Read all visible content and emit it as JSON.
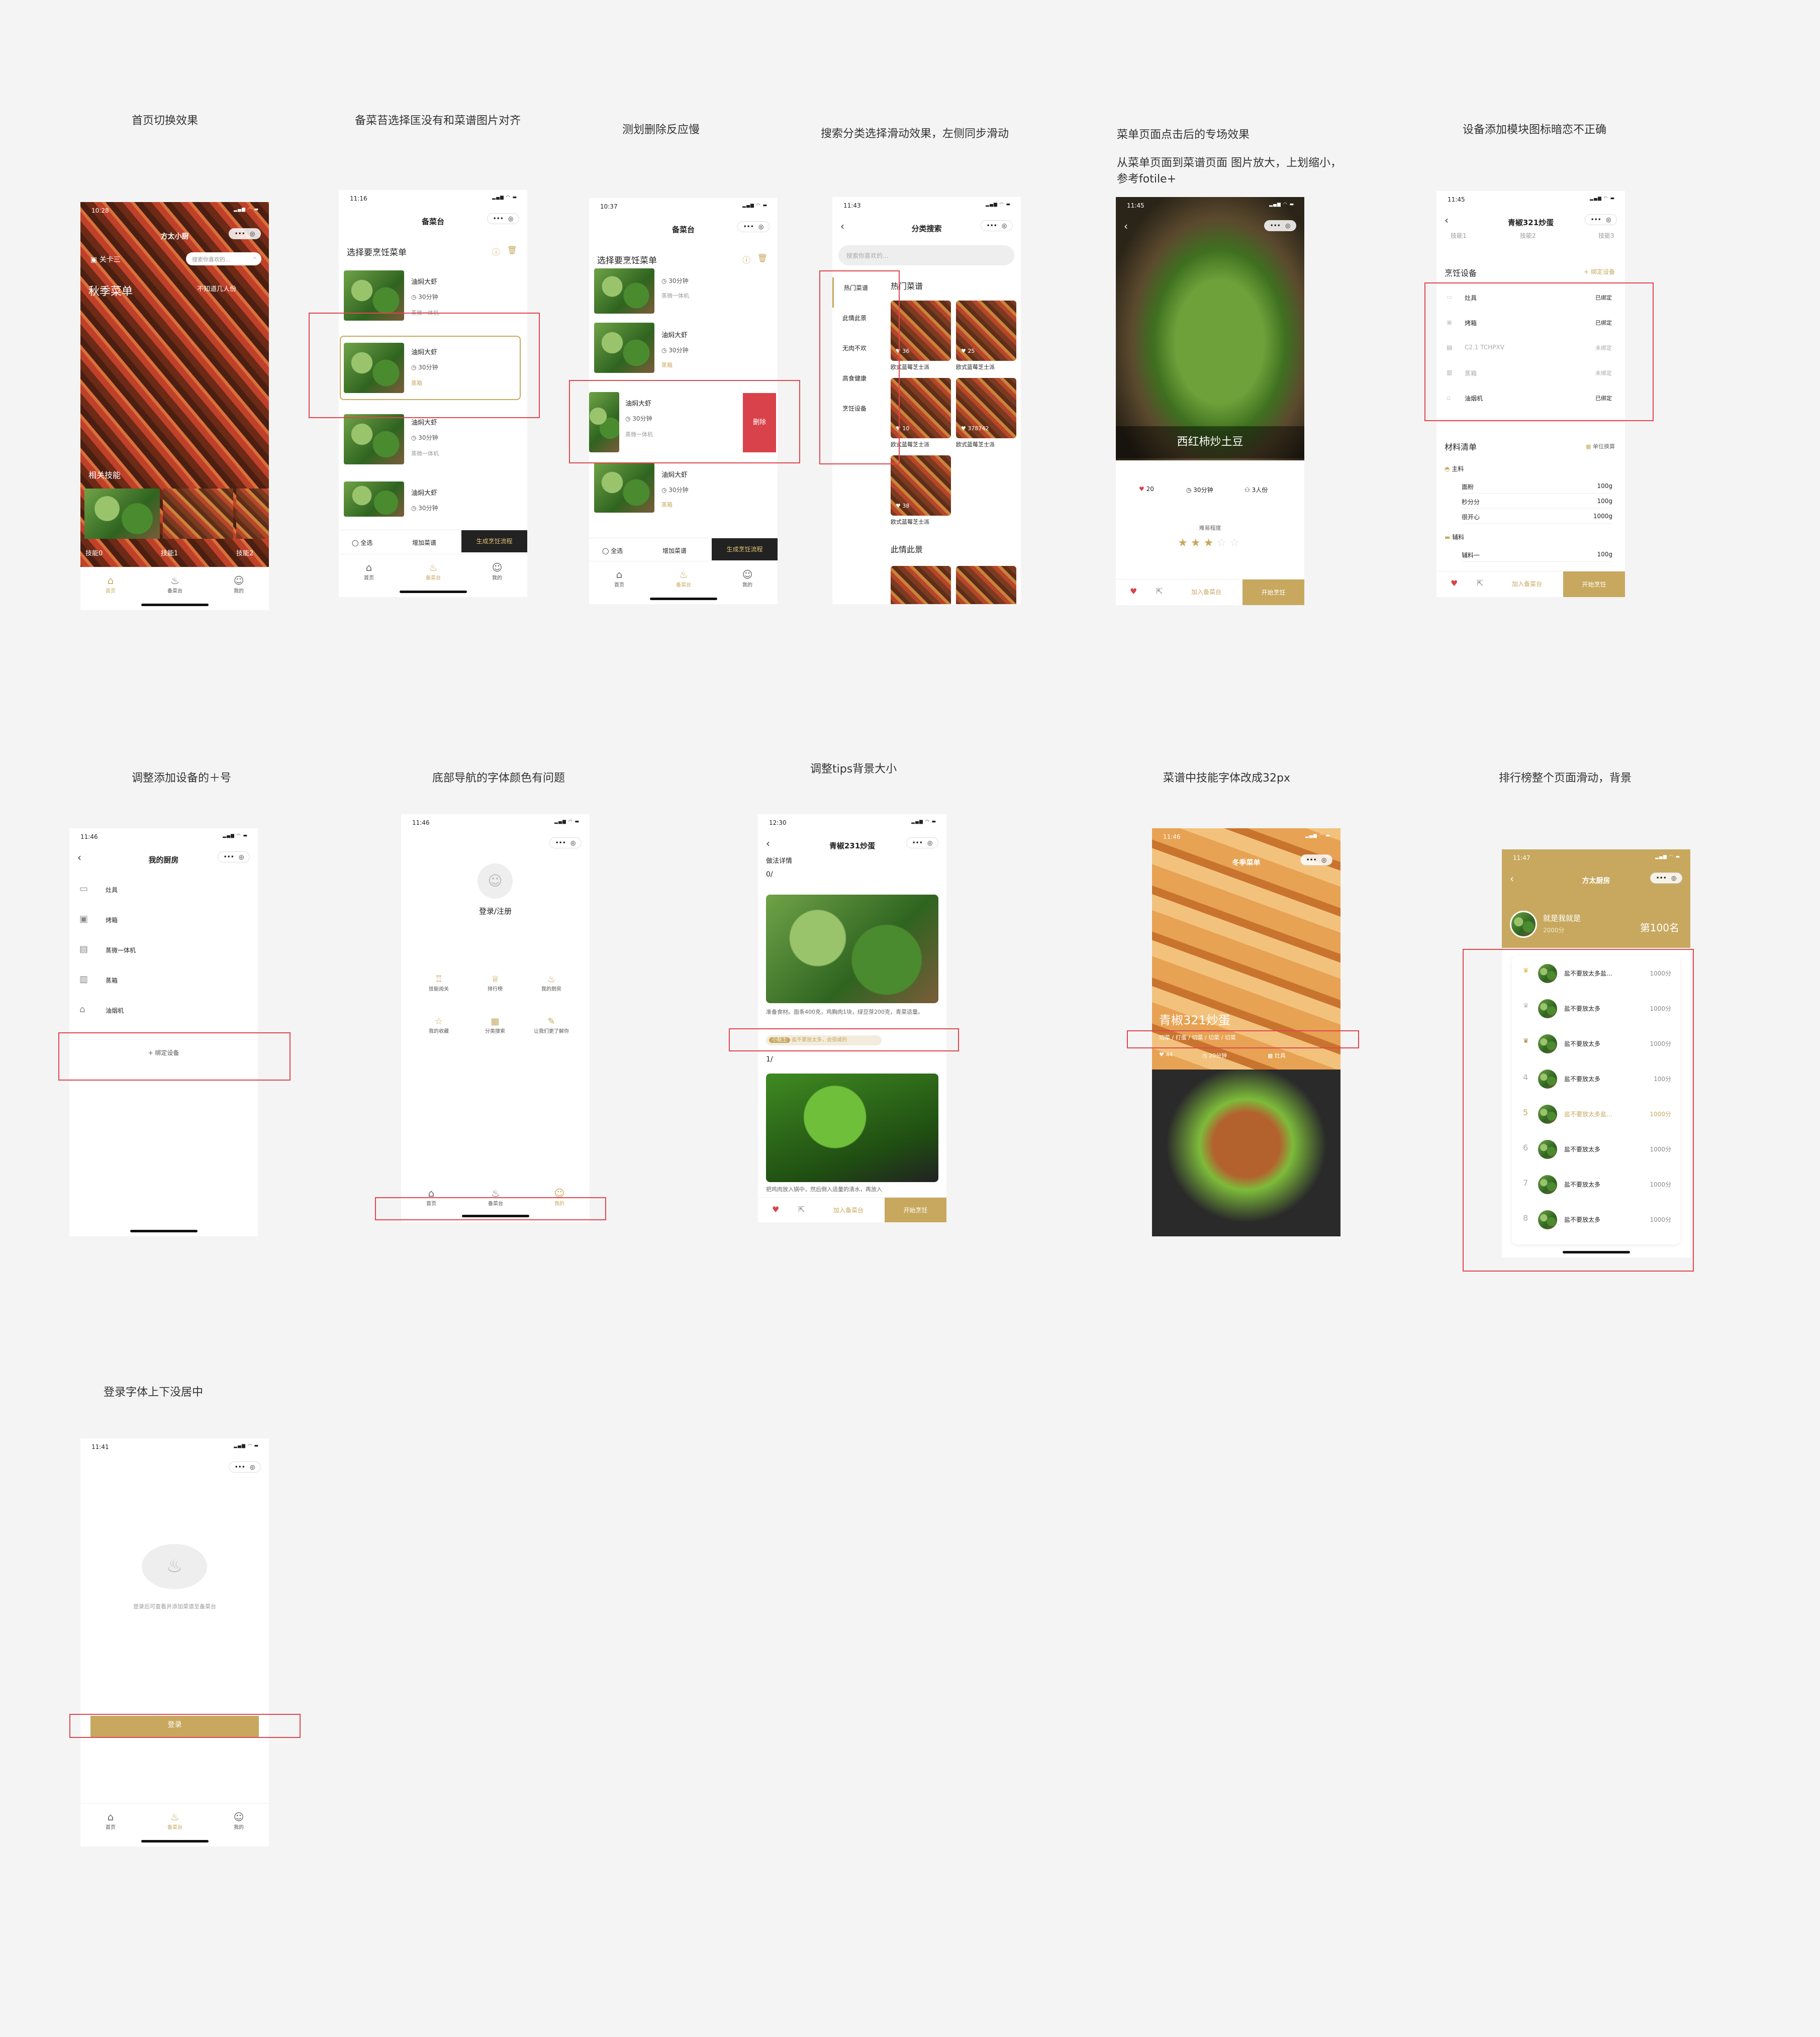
{
  "labels": {
    "l1": "首页切换效果",
    "l2": "备菜苔选择匡没有和菜谱图片对齐",
    "l3": "测划删除反应慢",
    "l4": "搜索分类选择滑动效果，左侧同步滑动",
    "l5a": "菜单页面点击后的专场效果",
    "l5b": "从菜单页面到菜谱页面 图片放大，上划缩小，",
    "l5c": "参考fotile+",
    "l6": "设备添加模块图标暗恋不正确",
    "l7": "调整添加设备的＋号",
    "l8": "底部导航的字体颜色有问题",
    "l9": "调整tips背景大小",
    "l10": "菜谱中技能字体改成32px",
    "l11": "排行榜整个页面滑动，背景",
    "l12": "登录字体上下没居中"
  },
  "common": {
    "more": "•••",
    "target": "◎",
    "signal": "▂▄▆ ◠ ▬",
    "back": "‹",
    "tab_home": "首页",
    "tab_prep": "备菜台",
    "tab_mine": "我的"
  },
  "s1": {
    "time": "10:28",
    "app": "方太小厨",
    "user": "关卡三",
    "search": "搜索你喜欢的...",
    "season": "秋季菜单",
    "people": "不知道几人份",
    "related": "相关技能",
    "skills": [
      "技能0",
      "技能1",
      "技能2"
    ]
  },
  "s2": {
    "time": "11:16",
    "title": "备菜台",
    "header": "选择要烹饪菜单",
    "items": [
      {
        "name": "油焖大虾",
        "time": "30分钟",
        "tag": "蒸微一体机"
      },
      {
        "name": "油焖大虾",
        "time": "30分钟",
        "tag": "蒸箱"
      },
      {
        "name": "油焖大虾",
        "time": "30分钟",
        "tag": "蒸微一体机"
      },
      {
        "name": "油焖大虾",
        "time": "30分钟",
        "tag": ""
      }
    ],
    "select_all": "全选",
    "add": "增加菜谱",
    "gen": "生成烹饪流程"
  },
  "s3": {
    "time": "10:37",
    "title": "备菜台",
    "header": "选择要烹饪菜单",
    "items": [
      {
        "name": "",
        "time": "30分钟",
        "tag": "蒸微一体机"
      },
      {
        "name": "油焖大虾",
        "time": "30分钟",
        "tag": "蒸箱"
      },
      {
        "name": "油焖大虾",
        "time": "30分钟",
        "tag": "蒸微一体机"
      },
      {
        "name": "油焖大虾",
        "time": "30分钟",
        "tag": "蒸箱"
      }
    ],
    "delete": "删除",
    "select_all": "全选",
    "add": "增加菜谱",
    "gen": "生成烹饪流程"
  },
  "s4": {
    "time": "11:43",
    "title": "分类搜索",
    "search": "搜索你喜欢的...",
    "cats": [
      "热门菜谱",
      "此情此景",
      "无肉不欢",
      "高食健康",
      "烹饪设备"
    ],
    "sec1": "热门菜谱",
    "sec2": "此情此景",
    "cards": [
      {
        "name": "欧式蓝莓芝士派",
        "likes": "36"
      },
      {
        "name": "欧式蓝莓芝士派",
        "likes": "25"
      },
      {
        "name": "欧式蓝莓芝士派",
        "likes": "10"
      },
      {
        "name": "欧式蓝莓芝士派",
        "likes": "378742"
      },
      {
        "name": "欧式蓝莓芝士派",
        "likes": "38"
      }
    ]
  },
  "s5": {
    "time": "11:45",
    "dish": "西红柿炒土豆",
    "likes": "20",
    "duration": "30分钟",
    "serves": "3人份",
    "diff": "难易程度",
    "add": "加入备菜台",
    "start": "开始烹饪"
  },
  "s6": {
    "time": "11:45",
    "title": "青椒321炒蛋",
    "skills": [
      "技能1",
      "技能2",
      "技能3"
    ],
    "devices_title": "烹饪设备",
    "bind": "+ 绑定设备",
    "devices": [
      {
        "name": "灶具",
        "status": "已绑定"
      },
      {
        "name": "烤箱",
        "status": "已绑定"
      },
      {
        "name": "C2.1 TCHPXV",
        "status": "未绑定"
      },
      {
        "name": "蒸箱",
        "status": "未绑定"
      },
      {
        "name": "油烟机",
        "status": "已绑定"
      }
    ],
    "mat_title": "材料清单",
    "unit": "单位换算",
    "main": "主料",
    "mats": [
      {
        "name": "面粉",
        "amt": "100g"
      },
      {
        "name": "秒分分",
        "amt": "100g"
      },
      {
        "name": "很开心",
        "amt": "1000g"
      }
    ],
    "sub": "辅料",
    "subs": [
      {
        "name": "辅料一",
        "amt": "100g"
      }
    ],
    "add": "加入备菜台",
    "start": "开始烹饪"
  },
  "s7": {
    "time": "11:46",
    "title": "我的厨房",
    "devices": [
      "灶具",
      "烤箱",
      "蒸微一体机",
      "蒸箱",
      "油烟机"
    ],
    "bind": "+ 绑定设备"
  },
  "s8": {
    "time": "11:46",
    "login": "登录/注册",
    "grid": [
      "技能阅关",
      "排行榜",
      "我的厨房",
      "我的收藏",
      "分类搜索",
      "让我们更了解你"
    ]
  },
  "s9": {
    "time": "12:30",
    "title": "青椒231炒蛋",
    "sub": "做法详情",
    "step0": "0/",
    "step0_text": "准备食材。面条400克，鸡胸肉1块，绿豆芽200克，青菜适量。",
    "tip_tag": "小贴士",
    "tip": "盐不要放太多，会很咸的",
    "step1": "1/",
    "step1_text": "把鸡肉放入锅中，然后倒入适量的清水，再放入",
    "add": "加入备菜台",
    "start": "开始烹饪"
  },
  "s10": {
    "time": "11:46",
    "app": "冬季菜单",
    "dish": "青椒321炒蛋",
    "skills": "切菜 / 打蛋 / 切菜 / 切菜 / 切菜",
    "likes": "44",
    "duration": "20分钟",
    "device": "灶具"
  },
  "s11": {
    "time": "11:47",
    "app": "方太厨房",
    "name": "就是我就是",
    "score": "2000分",
    "rank": "第100名",
    "rows": [
      {
        "rank": "1",
        "text": "盐不要放太多盐...",
        "score": "1000分"
      },
      {
        "rank": "2",
        "text": "盐不要放太多",
        "score": "1000分"
      },
      {
        "rank": "3",
        "text": "盐不要放太多",
        "score": "1000分"
      },
      {
        "rank": "4",
        "text": "盐不要放太多",
        "score": "100分"
      },
      {
        "rank": "5",
        "text": "盐不要放太多盐...",
        "score": "1000分"
      },
      {
        "rank": "6",
        "text": "盐不要放太多",
        "score": "1000分"
      },
      {
        "rank": "7",
        "text": "盐不要放太多",
        "score": "1000分"
      },
      {
        "rank": "8",
        "text": "盐不要放太多",
        "score": "1000分"
      }
    ]
  },
  "s12": {
    "time": "11:41",
    "hint": "登录后可查看并添加菜谱至备菜台",
    "login": "登录"
  },
  "colors": {
    "gold": "#c7a85e",
    "red": "#d9424a",
    "highlight": "#e0464e"
  }
}
